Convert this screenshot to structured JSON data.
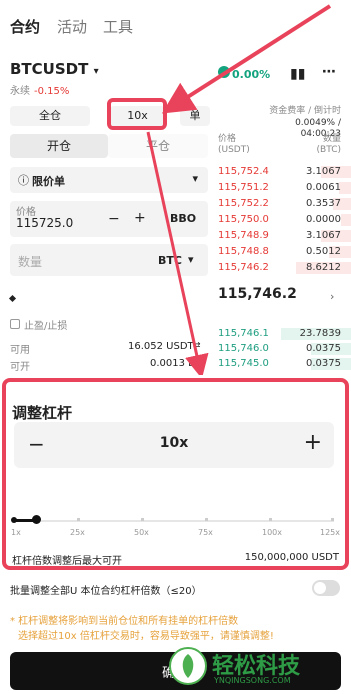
{
  "header": {
    "tabs": [
      "合约",
      "活动",
      "工具"
    ]
  },
  "pair": {
    "symbol": "BTCUSDT",
    "sub": "永续",
    "change": "-0.15%",
    "funding_change": "0.00%"
  },
  "controls": {
    "margin_mode": "全仓",
    "leverage": "10x",
    "pos_mode": "单",
    "open_tab": "开仓",
    "close_tab": "平仓",
    "order_type": "限价单",
    "price_label": "价格",
    "price_value": "115725.0",
    "bbo": "BBO",
    "qty_placeholder": "数量",
    "qty_unit": "BTC",
    "tpsl": "止盈/止损",
    "avail_label": "可用",
    "avail_value": "16.052 USDT",
    "open_label": "可开",
    "open_value": "0.0013 B"
  },
  "orderbook": {
    "funding_header": "资金费率 / 倒计时",
    "funding_value": "0.0049% / 04:00:23",
    "price_header": "价格",
    "price_unit": "(USDT)",
    "qty_header": "数量",
    "qty_unit": "(BTC)",
    "asks": [
      {
        "price": "115,752.4",
        "qty": "3.1067"
      },
      {
        "price": "115,751.2",
        "qty": "0.0061"
      },
      {
        "price": "115,752.2",
        "qty": "0.3537"
      },
      {
        "price": "115,750.0",
        "qty": "0.0000"
      },
      {
        "price": "115,748.9",
        "qty": "3.1067"
      },
      {
        "price": "115,748.8",
        "qty": "0.5012"
      },
      {
        "price": "115,746.2",
        "qty": "8.6212"
      }
    ],
    "mid": "115,746.2",
    "bids": [
      {
        "price": "115,746.1",
        "qty": "23.7839"
      },
      {
        "price": "115,746.0",
        "qty": "0.0375"
      },
      {
        "price": "115,745.0",
        "qty": "0.0375"
      }
    ]
  },
  "sheet": {
    "title": "调整杠杆",
    "minus": "−",
    "plus": "+",
    "leverage": "10x",
    "ticks": [
      "1x",
      "25x",
      "50x",
      "75x",
      "100x",
      "125x"
    ],
    "max_label": "杠杆倍数调整后最大可开",
    "max_value": "150,000,000 USDT",
    "batch_label": "批量调整全部U 本位合约杠杆倍数（≤20）",
    "warn1": "* 杠杆调整将影响到当前仓位和所有挂单的杠杆倍数",
    "warn2": "选择超过10x 倍杠杆交易时，容易导致强平，请谨慎调整!",
    "confirm_partial": "确"
  },
  "watermark": {
    "main": "轻松科技",
    "sub": "YNQINGSONG.COM"
  },
  "colors": {
    "highlight": "#e8435a",
    "ask": "#e53935",
    "bid": "#1e9e80",
    "warn": "#e6a23c"
  }
}
